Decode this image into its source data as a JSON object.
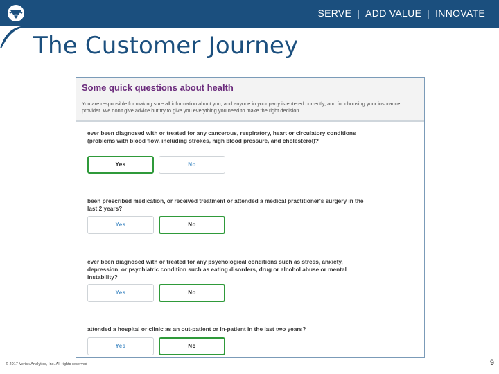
{
  "header": {
    "logo_icon": "company-logo-icon",
    "tagline": [
      "SERVE",
      "ADD VALUE",
      "INNOVATE"
    ],
    "separator": "|"
  },
  "slide": {
    "title": "The Customer Journey",
    "page_number": "9",
    "footer": "© 2017 Verisk Analytics, Inc. All rights reserved"
  },
  "form": {
    "title": "Some quick questions about health",
    "intro": "You are responsible for making sure all information about you, and anyone in your party is entered correctly, and for choosing your insurance provider. We don't give advice but try to give you everything you need to make the right decision.",
    "yes_label": "Yes",
    "no_label": "No",
    "selected_color": "#2f9a3a",
    "questions": [
      {
        "text": "ever been diagnosed with or treated for any cancerous, respiratory, heart or circulatory conditions (problems with blood flow, including strokes, high blood pressure, and cholesterol)?",
        "selected": "Yes"
      },
      {
        "text": "been prescribed medication, or received treatment or attended a medical practitioner's surgery in the last 2 years?",
        "selected": "No"
      },
      {
        "text": "ever been diagnosed with or treated for any psychological conditions such as stress, anxiety, depression, or psychiatric condition such as eating disorders, drug or alcohol abuse or mental instability?",
        "selected": "No"
      },
      {
        "text": "attended a hospital or clinic as an out-patient or in-patient in the last two years?",
        "selected": "No"
      }
    ]
  }
}
